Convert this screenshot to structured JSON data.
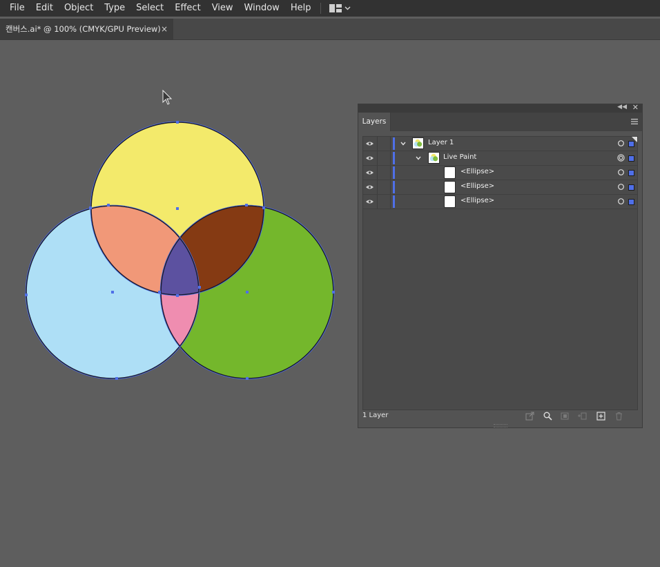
{
  "menubar": {
    "items": [
      "File",
      "Edit",
      "Object",
      "Type",
      "Select",
      "Effect",
      "View",
      "Window",
      "Help"
    ],
    "workspace_switcher_icon": "workspace-grid-icon"
  },
  "document_tab": {
    "title": "캔버스.ai* @ 100% (CMYK/GPU Preview)",
    "close_glyph": "×"
  },
  "artwork": {
    "description_fills": {
      "yellow": "#f3ea6b",
      "blue": "#aedff6",
      "green": "#74b72c",
      "yellow_blue": "#f19878",
      "yellow_green": "#853a13",
      "blue_green": "#ef8db0",
      "center": "#5c51a0"
    },
    "selection_color": "#4f6fe8"
  },
  "layers_panel": {
    "tab_label": "Layers",
    "rows": [
      {
        "label": "Layer 1"
      },
      {
        "label": "Live Paint"
      },
      {
        "label": "<Ellipse>"
      },
      {
        "label": "<Ellipse>"
      },
      {
        "label": "<Ellipse>"
      }
    ],
    "footer": {
      "layer_count": "1 Layer"
    }
  },
  "colors": {
    "canvas_bg": "#5e5e5e",
    "layer_color": "#4f6fe8"
  }
}
